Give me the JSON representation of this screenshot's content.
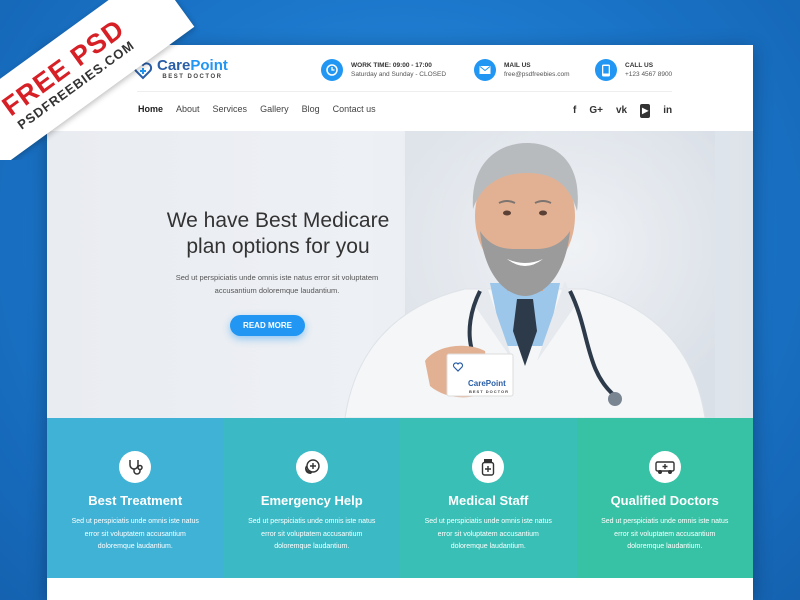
{
  "ribbon": {
    "line1": "FREE PSD",
    "line2": "PSDFREEBIES.COM"
  },
  "logo": {
    "name_a": "Care",
    "name_b": "Point",
    "subtitle": "BEST DOCTOR"
  },
  "contacts": [
    {
      "icon": "clock-icon",
      "title": "WORK TIME: 09:00 - 17:00",
      "value": "Saturday and Sunday - CLOSED"
    },
    {
      "icon": "mail-icon",
      "title": "MAIL US",
      "value": "free@psdfreebies.com"
    },
    {
      "icon": "phone-icon",
      "title": "CALL US",
      "value": "+123 4567 8900"
    }
  ],
  "nav": [
    {
      "label": "Home",
      "active": true
    },
    {
      "label": "About"
    },
    {
      "label": "Services"
    },
    {
      "label": "Gallery"
    },
    {
      "label": "Blog"
    },
    {
      "label": "Contact us"
    }
  ],
  "social": [
    {
      "icon": "facebook-icon",
      "glyph": "f"
    },
    {
      "icon": "google-plus-icon",
      "glyph": "G+"
    },
    {
      "icon": "vk-icon",
      "glyph": "vk"
    },
    {
      "icon": "youtube-icon",
      "glyph": "▶"
    },
    {
      "icon": "linkedin-icon",
      "glyph": "in"
    }
  ],
  "hero": {
    "heading": "We have Best Medicare plan options for you",
    "text": "Sed ut perspiciatis unde omnis iste natus error sit voluptatem accusantium doloremque laudantium.",
    "button": "READ MORE",
    "card_name": "CarePoint",
    "card_sub": "BEST DOCTOR"
  },
  "features": [
    {
      "icon": "stethoscope-icon",
      "title": "Best Treatment",
      "desc": "Sed ut perspiciatis unde omnis iste natus error sit voluptatem accusantium doloremque laudantium."
    },
    {
      "icon": "emergency-phone-icon",
      "title": "Emergency Help",
      "desc": "Sed ut perspiciatis unde omnis iste natus error sit voluptatem accusantium doloremque laudantium."
    },
    {
      "icon": "medicine-bottle-icon",
      "title": "Medical Staff",
      "desc": "Sed ut perspiciatis unde omnis iste natus error sit voluptatem accusantium doloremque laudantium."
    },
    {
      "icon": "ambulance-icon",
      "title": "Qualified Doctors",
      "desc": "Sed ut perspiciatis unde omnis iste natus error sit voluptatem accusantium doloremque laudantium."
    }
  ],
  "colors": {
    "accent": "#2196f3",
    "brand": "#2a5ea8",
    "ribbon_red": "#d71f26"
  }
}
